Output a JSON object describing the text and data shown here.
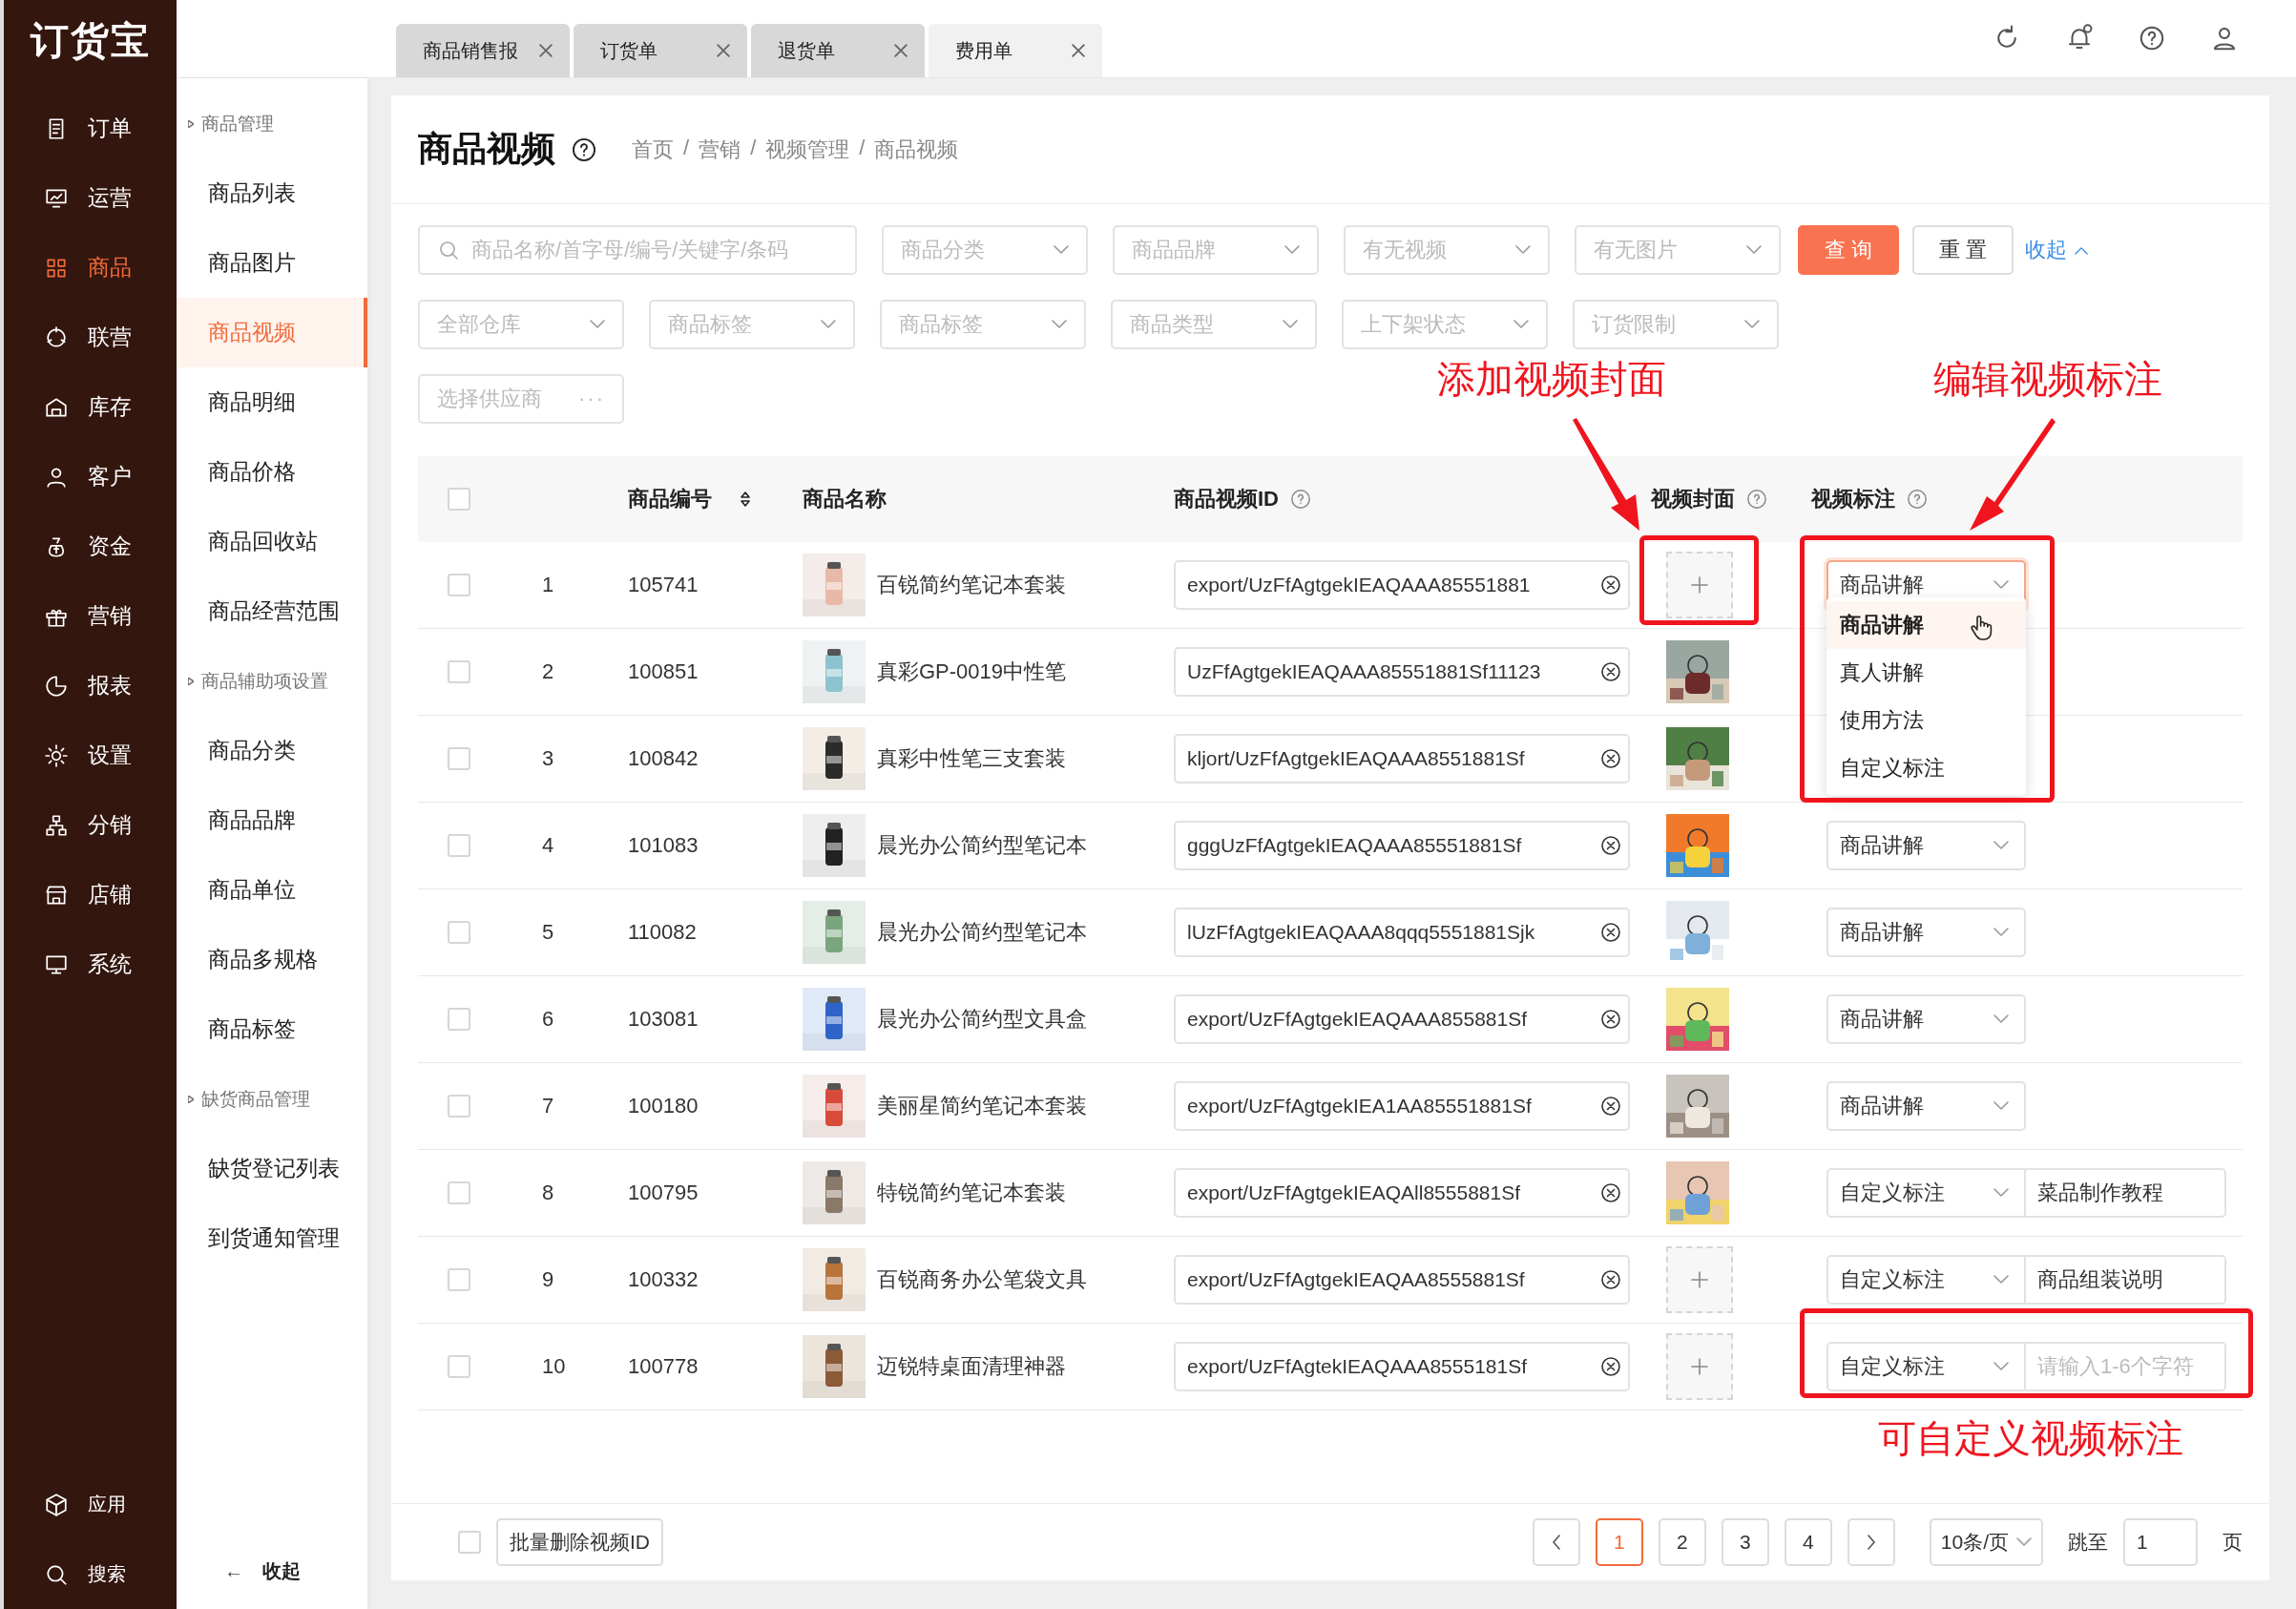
{
  "app": {
    "logo": "订货宝"
  },
  "main_nav": [
    {
      "label": "订单",
      "selected": false
    },
    {
      "label": "运营",
      "selected": false
    },
    {
      "label": "商品",
      "selected": true
    },
    {
      "label": "联营",
      "selected": false
    },
    {
      "label": "库存",
      "selected": false
    },
    {
      "label": "客户",
      "selected": false
    },
    {
      "label": "资金",
      "selected": false
    },
    {
      "label": "营销",
      "selected": false
    },
    {
      "label": "报表",
      "selected": false
    },
    {
      "label": "设置",
      "selected": false
    },
    {
      "label": "分销",
      "selected": false
    },
    {
      "label": "店铺",
      "selected": false
    },
    {
      "label": "系统",
      "selected": false
    }
  ],
  "main_nav_bottom": [
    {
      "label": "应用"
    },
    {
      "label": "搜索"
    }
  ],
  "sub_nav": [
    {
      "kind": "group",
      "label": "商品管理"
    },
    {
      "kind": "item",
      "label": "商品列表",
      "selected": false
    },
    {
      "kind": "item",
      "label": "商品图片",
      "selected": false
    },
    {
      "kind": "item",
      "label": "商品视频",
      "selected": true
    },
    {
      "kind": "item",
      "label": "商品明细",
      "selected": false
    },
    {
      "kind": "item",
      "label": "商品价格",
      "selected": false
    },
    {
      "kind": "item",
      "label": "商品回收站",
      "selected": false
    },
    {
      "kind": "item",
      "label": "商品经营范围",
      "selected": false
    },
    {
      "kind": "group",
      "label": "商品辅助项设置"
    },
    {
      "kind": "item",
      "label": "商品分类",
      "selected": false
    },
    {
      "kind": "item",
      "label": "商品品牌",
      "selected": false
    },
    {
      "kind": "item",
      "label": "商品单位",
      "selected": false
    },
    {
      "kind": "item",
      "label": "商品多规格",
      "selected": false
    },
    {
      "kind": "item",
      "label": "商品标签",
      "selected": false
    },
    {
      "kind": "group",
      "label": "缺货商品管理"
    },
    {
      "kind": "item",
      "label": "缺货登记列表",
      "selected": false
    },
    {
      "kind": "item",
      "label": "到货通知管理",
      "selected": false
    }
  ],
  "sub_nav_collapse": {
    "arrow": "←",
    "label": "收起"
  },
  "tabs": [
    {
      "label": "商品销售报",
      "selected": false
    },
    {
      "label": "订货单",
      "selected": false
    },
    {
      "label": "退货单",
      "selected": false
    },
    {
      "label": "费用单",
      "selected": true
    }
  ],
  "notifications": {
    "unread": true
  },
  "page": {
    "title": "商品视频",
    "breadcrumbs": [
      "首页",
      "营销",
      "视频管理",
      "商品视频"
    ],
    "separator": "/"
  },
  "filter_rows": [
    [
      {
        "kind": "search",
        "placeholder": "商品名称/首字母/编号/关键字/条码"
      },
      {
        "kind": "select",
        "placeholder": "商品分类"
      },
      {
        "kind": "select",
        "placeholder": "商品品牌"
      },
      {
        "kind": "select",
        "placeholder": "有无视频"
      },
      {
        "kind": "select",
        "placeholder": "有无图片"
      },
      {
        "kind": "primary",
        "label": "查 询"
      },
      {
        "kind": "default",
        "label": "重 置"
      },
      {
        "kind": "link",
        "label": "收起"
      }
    ],
    [
      {
        "kind": "select",
        "placeholder": "全部仓库"
      },
      {
        "kind": "select",
        "placeholder": "商品标签"
      },
      {
        "kind": "select",
        "placeholder": "商品标签"
      },
      {
        "kind": "select",
        "placeholder": "商品类型"
      },
      {
        "kind": "select",
        "placeholder": "上下架状态"
      },
      {
        "kind": "select",
        "placeholder": "订货限制"
      }
    ],
    [
      {
        "kind": "picker",
        "placeholder": "选择供应商",
        "more": "···"
      }
    ]
  ],
  "table": {
    "select_all": false,
    "columns": [
      "商品编号",
      "商品名称",
      "商品视频ID",
      "视频封面",
      "视频标注"
    ],
    "rows": [
      {
        "checked": false,
        "index": "1",
        "code": "105741",
        "name": "百锐简约笔记本套装",
        "video_id": "export/UzFfAgtgekIEAQAAA85551881",
        "cover": {
          "kind": "empty"
        },
        "tag": {
          "value": "商品讲解",
          "open": true,
          "options": [
            {
              "label": "商品讲解",
              "selected": true
            },
            {
              "label": "真人讲解",
              "selected": false
            },
            {
              "label": "使用方法",
              "selected": false
            },
            {
              "label": "自定义标注",
              "selected": false
            }
          ]
        }
      },
      {
        "checked": false,
        "index": "2",
        "code": "100851",
        "name": "真彩GP-0019中性笔",
        "video_id": "UzFfAgtgekIEAQAAA85551881Sf11123"
      },
      {
        "checked": false,
        "index": "3",
        "code": "100842",
        "name": "真彩中性笔三支套装",
        "video_id": "kljort/UzFfAgtgekIEAQAAA8551881Sf"
      },
      {
        "checked": false,
        "index": "4",
        "code": "101083",
        "name": "晨光办公简约型笔记本",
        "video_id": "gggUzFfAgtgekIEAQAAA85551881Sf",
        "tag": {
          "value": "商品讲解",
          "open": false
        }
      },
      {
        "checked": false,
        "index": "5",
        "code": "110082",
        "name": "晨光办公简约型笔记本",
        "video_id": "lUzFfAgtgekIEAQAAA8qqq5551881Sjk",
        "tag": {
          "value": "商品讲解",
          "open": false
        }
      },
      {
        "checked": false,
        "index": "6",
        "code": "103081",
        "name": "晨光办公简约型文具盒",
        "video_id": "export/UzFfAgtgekIEAQAAA855881Sf",
        "tag": {
          "value": "商品讲解",
          "open": false
        }
      },
      {
        "checked": false,
        "index": "7",
        "code": "100180",
        "name": "美丽星简约笔记本套装",
        "video_id": "export/UzFfAgtgekIEA1AA85551881Sf",
        "tag": {
          "value": "商品讲解",
          "open": false
        }
      },
      {
        "checked": false,
        "index": "8",
        "code": "100795",
        "name": "特锐简约笔记本套装",
        "video_id": "export/UzFfAgtgekIEAQAll8555881Sf",
        "tag": {
          "value": "自定义标注",
          "open": false,
          "custom": {
            "value": "菜品制作教程"
          }
        }
      },
      {
        "checked": false,
        "index": "9",
        "code": "100332",
        "name": "百锐商务办公笔袋文具",
        "video_id": "export/UzFfAgtgekIEAQAA8555881Sf",
        "cover": {
          "kind": "empty"
        },
        "tag": {
          "value": "自定义标注",
          "open": false,
          "custom": {
            "value": "商品组装说明"
          }
        }
      },
      {
        "checked": false,
        "index": "10",
        "code": "100778",
        "name": "迈锐特桌面清理神器",
        "video_id": "export/UzFfAgtekIEAQAAA8555181Sf",
        "cover": {
          "kind": "empty"
        },
        "tag": {
          "value": "自定义标注",
          "open": false,
          "custom": {
            "placeholder": "请输入1-6个字符"
          }
        }
      }
    ]
  },
  "annotations": [
    {
      "text": "添加视频封面"
    },
    {
      "text": "编辑视频标注"
    },
    {
      "text": "可自定义视频标注"
    }
  ],
  "footer": {
    "select_all": false,
    "bulk_button": "批量删除视频ID",
    "pages": [
      {
        "label": "1",
        "selected": true
      },
      {
        "label": "2",
        "selected": false
      },
      {
        "label": "3",
        "selected": false
      },
      {
        "label": "4",
        "selected": false
      }
    ],
    "page_size": "10条/页",
    "jump_label": "跳至",
    "jump_value": "1",
    "page_unit": "页"
  }
}
